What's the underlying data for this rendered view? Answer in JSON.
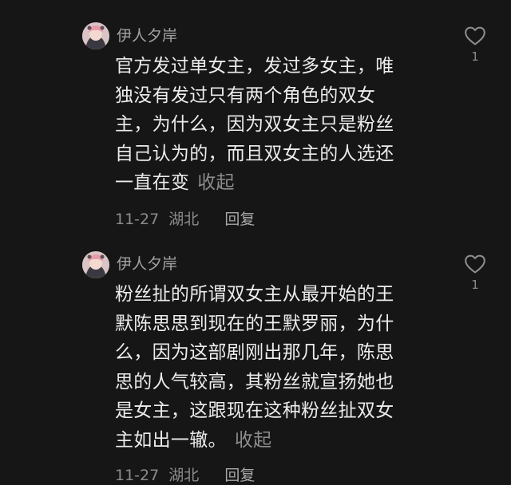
{
  "comments": [
    {
      "username": "伊人夕岸",
      "lines": [
        "官方发过单女主，发过多女主，唯",
        "独没有发过只有两个角色的双女",
        "主，为什么，因为双女主只是粉丝",
        "自己认为的，而且双女主的人选还",
        "一直在变"
      ],
      "collapse_label": "收起",
      "date": "11-27",
      "location": "湖北",
      "reply_label": "回复",
      "likes": "1",
      "like_icon": "heart-outline-icon"
    },
    {
      "username": "伊人夕岸",
      "lines": [
        "粉丝扯的所谓双女主从最开始的王",
        "默陈思思到现在的王默罗丽，为什",
        "么，因为这部剧刚出那几年，陈思",
        "思的人气较高，其粉丝就宣扬她也",
        "是女主，这跟现在这种粉丝扯双女",
        "主如出一辙。"
      ],
      "collapse_label": "收起",
      "date": "11-27",
      "location": "湖北",
      "reply_label": "回复",
      "likes": "1",
      "like_icon": "heart-outline-icon"
    }
  ],
  "colors": {
    "background": "#161616",
    "text": "#ececec",
    "secondary": "#8b8b8b"
  }
}
